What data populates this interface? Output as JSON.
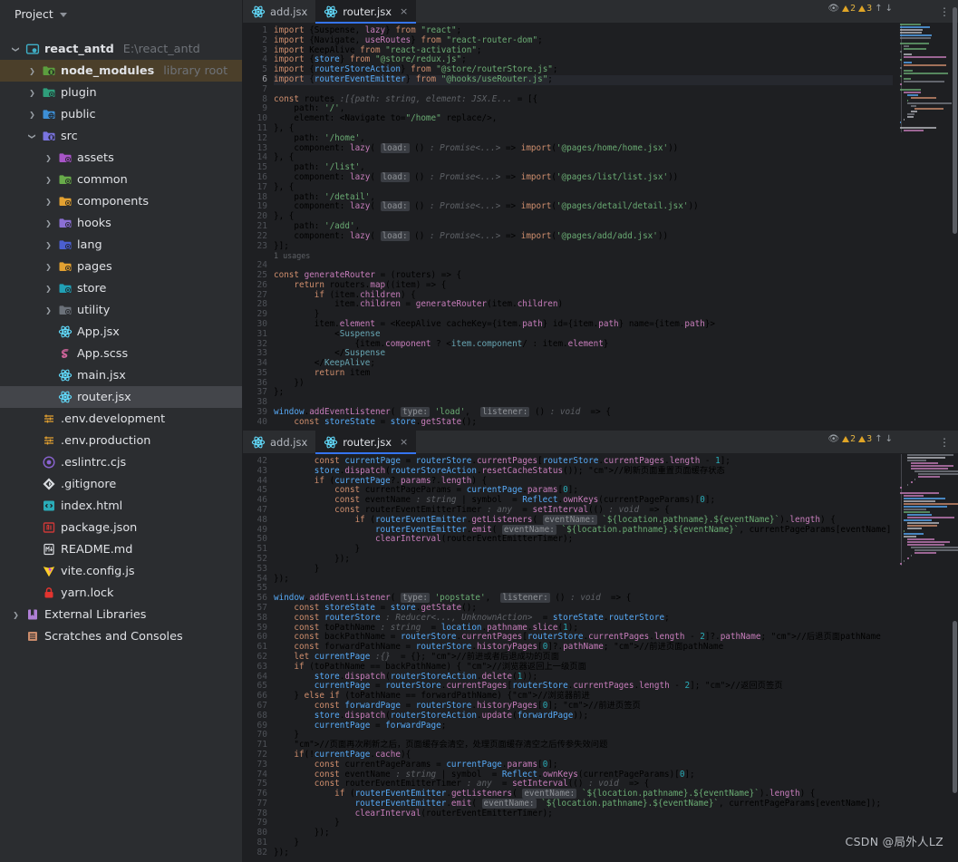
{
  "sidebar": {
    "header": {
      "title": "Project",
      "chevron_icon": "chevron-down-icon"
    },
    "items": [
      {
        "label": "react_antd",
        "sub": "E:\\react_antd",
        "icon": "module-folder-icon",
        "color": "#3fb0c8",
        "indent": 0,
        "arrow": "down",
        "bold": true,
        "state": "normal"
      },
      {
        "label": "node_modules",
        "sub": "library root",
        "icon": "library-folder-icon",
        "color": "#5c9e3e",
        "indent": 1,
        "arrow": "right",
        "bold": true,
        "state": "highlight"
      },
      {
        "label": "plugin",
        "sub": "",
        "icon": "folder-icon",
        "color": "#2f9e7b",
        "indent": 1,
        "arrow": "right",
        "bold": false,
        "state": "normal"
      },
      {
        "label": "public",
        "sub": "",
        "icon": "folder-web-icon",
        "color": "#3d8fd6",
        "indent": 1,
        "arrow": "right",
        "bold": false,
        "state": "normal"
      },
      {
        "label": "src",
        "sub": "",
        "icon": "source-folder-icon",
        "color": "#7a74e0",
        "indent": 1,
        "arrow": "down",
        "bold": false,
        "state": "normal"
      },
      {
        "label": "assets",
        "sub": "",
        "icon": "folder-icon",
        "color": "#a855c8",
        "indent": 2,
        "arrow": "right",
        "bold": false,
        "state": "normal"
      },
      {
        "label": "common",
        "sub": "",
        "icon": "folder-icon",
        "color": "#68ab4a",
        "indent": 2,
        "arrow": "right",
        "bold": false,
        "state": "normal"
      },
      {
        "label": "components",
        "sub": "",
        "icon": "folder-icon",
        "color": "#e3a131",
        "indent": 2,
        "arrow": "right",
        "bold": false,
        "state": "normal"
      },
      {
        "label": "hooks",
        "sub": "",
        "icon": "folder-icon",
        "color": "#8b6fd4",
        "indent": 2,
        "arrow": "right",
        "bold": false,
        "state": "normal"
      },
      {
        "label": "lang",
        "sub": "",
        "icon": "folder-icon",
        "color": "#4b5fd0",
        "indent": 2,
        "arrow": "right",
        "bold": false,
        "state": "normal"
      },
      {
        "label": "pages",
        "sub": "",
        "icon": "folder-icon",
        "color": "#e3a131",
        "indent": 2,
        "arrow": "right",
        "bold": false,
        "state": "normal"
      },
      {
        "label": "store",
        "sub": "",
        "icon": "folder-icon",
        "color": "#21a0b5",
        "indent": 2,
        "arrow": "right",
        "bold": false,
        "state": "normal"
      },
      {
        "label": "utility",
        "sub": "",
        "icon": "folder-icon",
        "color": "#6b7179",
        "indent": 2,
        "arrow": "right",
        "bold": false,
        "state": "normal"
      },
      {
        "label": "App.jsx",
        "sub": "",
        "icon": "react-icon",
        "color": "#61dafb",
        "indent": 2,
        "arrow": "none",
        "bold": false,
        "state": "normal"
      },
      {
        "label": "App.scss",
        "sub": "",
        "icon": "sass-icon",
        "color": "#cf649a",
        "indent": 2,
        "arrow": "none",
        "bold": false,
        "state": "normal"
      },
      {
        "label": "main.jsx",
        "sub": "",
        "icon": "react-icon",
        "color": "#61dafb",
        "indent": 2,
        "arrow": "none",
        "bold": false,
        "state": "normal"
      },
      {
        "label": "router.jsx",
        "sub": "",
        "icon": "react-icon",
        "color": "#61dafb",
        "indent": 2,
        "arrow": "none",
        "bold": false,
        "state": "selected"
      },
      {
        "label": ".env.development",
        "sub": "",
        "icon": "env-icon",
        "color": "#e3a131",
        "indent": 1,
        "arrow": "none",
        "bold": false,
        "state": "normal"
      },
      {
        "label": ".env.production",
        "sub": "",
        "icon": "env-icon",
        "color": "#e3a131",
        "indent": 1,
        "arrow": "none",
        "bold": false,
        "state": "normal"
      },
      {
        "label": ".eslintrc.cjs",
        "sub": "",
        "icon": "eslint-icon",
        "color": "#8a63d2",
        "indent": 1,
        "arrow": "none",
        "bold": false,
        "state": "normal"
      },
      {
        "label": ".gitignore",
        "sub": "",
        "icon": "git-icon",
        "color": "#d9dce0",
        "indent": 1,
        "arrow": "none",
        "bold": false,
        "state": "normal"
      },
      {
        "label": "index.html",
        "sub": "",
        "icon": "html-icon",
        "color": "#2aacb8",
        "indent": 1,
        "arrow": "none",
        "bold": false,
        "state": "normal"
      },
      {
        "label": "package.json",
        "sub": "",
        "icon": "npm-icon",
        "color": "#cb3837",
        "indent": 1,
        "arrow": "none",
        "bold": false,
        "state": "normal"
      },
      {
        "label": "README.md",
        "sub": "",
        "icon": "markdown-icon",
        "color": "#d9dce0",
        "indent": 1,
        "arrow": "none",
        "bold": false,
        "state": "normal"
      },
      {
        "label": "vite.config.js",
        "sub": "",
        "icon": "vite-icon",
        "color": "#ffd028",
        "indent": 1,
        "arrow": "none",
        "bold": false,
        "state": "normal"
      },
      {
        "label": "yarn.lock",
        "sub": "",
        "icon": "lock-icon",
        "color": "#e3342f",
        "indent": 1,
        "arrow": "none",
        "bold": false,
        "state": "normal"
      },
      {
        "label": "External Libraries",
        "sub": "",
        "icon": "libraries-icon",
        "color": "#b07fd6",
        "indent": 0,
        "arrow": "right",
        "bold": false,
        "state": "normal"
      },
      {
        "label": "Scratches and Consoles",
        "sub": "",
        "icon": "scratches-icon",
        "color": "#c98b6b",
        "indent": 0,
        "arrow": "none",
        "bold": false,
        "state": "normal"
      }
    ]
  },
  "panes": [
    {
      "id": "pane-top",
      "tabs": [
        {
          "label": "add.jsx",
          "icon": "react-icon",
          "active": false,
          "closable": false
        },
        {
          "label": "router.jsx",
          "icon": "react-icon",
          "active": true,
          "closable": true
        }
      ],
      "inspection": {
        "eye_icon": "eye-icon",
        "warning_icon": "warning-triangle-icon",
        "warnings": "2",
        "weak_warnings": "3",
        "up_icon": "arrow-up-icon",
        "down_icon": "arrow-down-icon"
      },
      "first_line": 1,
      "current_line": 6,
      "lines": [
        "import {Suspense, lazy} from \"react\";",
        "import {Navigate, useRoutes} from \"react-router-dom\";",
        "import KeepAlive from \"react-activation\";",
        "import {store} from \"@store/redux.js\";",
        "import {routerStoreAction} from \"@store/routerStore.js\";",
        "import {routerEventEmitter} from \"@hooks/useRouter.js\";",
        "",
        "const routes :[{path: string, element: JSX.E... = [{",
        "    path: '/',",
        "    element: <Navigate to=\"/home\" replace/>,",
        "}, {",
        "    path: '/home',",
        "    component: lazy( load: () : Promise<...> => import('@pages/home/home.jsx'))",
        "}, {",
        "    path: '/list',",
        "    component: lazy( load: () : Promise<...> => import('@pages/list/list.jsx'))",
        "}, {",
        "    path: '/detail',",
        "    component: lazy( load: () : Promise<...> => import('@pages/detail/detail.jsx'))",
        "}, {",
        "    path: '/add',",
        "    component: lazy( load: () : Promise<...> => import('@pages/add/add.jsx'))",
        "}];",
        "",
        "const generateRouter = (routers) => {",
        "    return routers.map((item) => {",
        "        if (item.children) {",
        "            item.children = generateRouter(item.children)",
        "        }",
        "        item.element = <KeepAlive cacheKey={item.path} id={item.path} name={item.path}>",
        "            <Suspense>",
        "                {item.component ? <item.component/> : item.element}",
        "            </Suspense>",
        "        </KeepAlive>;",
        "        return item",
        "    })",
        "};",
        "",
        "window.addEventListener( type: 'load',  listener: () : void  => {",
        "    const storeState = store.getState();"
      ],
      "usages_label": "1 usages"
    },
    {
      "id": "pane-bot",
      "tabs": [
        {
          "label": "add.jsx",
          "icon": "react-icon",
          "active": false,
          "closable": false
        },
        {
          "label": "router.jsx",
          "icon": "react-icon",
          "active": true,
          "closable": true
        }
      ],
      "inspection": {
        "eye_icon": "eye-icon",
        "warning_icon": "warning-triangle-icon",
        "warnings": "2",
        "weak_warnings": "3",
        "up_icon": "arrow-up-icon",
        "down_icon": "arrow-down-icon"
      },
      "first_line": 42,
      "lines": [
        "        const currentPage = routerStore.currentPages[routerStore.currentPages.length - 1];",
        "        store.dispatch(routerStoreAction.resetCacheStatus()); //刷新页面重置页面缓存状态",
        "        if (currentPage?.params?.length) {",
        "            const currentPageParams = currentPage.params[0];",
        "            const eventName : string | symbol  = Reflect.ownKeys(currentPageParams)[0];",
        "            const routerEventEmitterTimer : any  = setInterval(() : void  => {",
        "                if (routerEventEmitter.getListeners( eventName: `${location.pathname}.${eventName}`).length) {",
        "                    routerEventEmitter.emit( eventName: `${location.pathname}.${eventName}`, currentPageParams[eventName]);",
        "                    clearInterval(routerEventEmitterTimer);",
        "                }",
        "            });",
        "        }",
        "});",
        "",
        "window.addEventListener( type: 'popstate',  listener: () : void  => {",
        "    const storeState = store.getState();",
        "    const routerStore : Reducer<..., UnknownAction>  = storeState.routerStore;",
        "    const toPathName : string  = location.pathname.slice(1);",
        "    const backPathName = routerStore.currentPages[routerStore.currentPages.length - 2]?.pathName; //后退页面pathName",
        "    const forwardPathName = routerStore.historyPages[0]?.pathName; //前进页面pathName",
        "    let currentPage :{}  = {}; //前进或者后退成功的页面",
        "    if (toPathName == backPathName) { //浏览器返回上一级页面",
        "        store.dispatch(routerStoreAction.delete(1));",
        "        currentPage = routerStore.currentPages[routerStore.currentPages.length - 2]; //返回页签页",
        "    } else if (toPathName == forwardPathName) {//浏览器前进",
        "        const forwardPage = routerStore.historyPages[0]; //前进页签页",
        "        store.dispatch(routerStoreAction.update(forwardPage));",
        "        currentPage = forwardPage;",
        "    }",
        "    //页面再次刷新之后，页面缓存会清空，处理页面缓存清空之后传参失效问题",
        "    if(!currentPage.cache){",
        "        const currentPageParams = currentPage.params[0];",
        "        const eventName : string | symbol  = Reflect.ownKeys(currentPageParams)[0];",
        "        const routerEventEmitterTimer : any  = setInterval(() : void  => {",
        "            if (routerEventEmitter.getListeners( eventName: `${location.pathname}.${eventName}`).length) {",
        "                routerEventEmitter.emit( eventName: `${location.pathname}.${eventName}`, currentPageParams[eventName]);",
        "                clearInterval(routerEventEmitterTimer);",
        "            }",
        "        });",
        "    }",
        "});"
      ]
    }
  ],
  "watermark": {
    "text": "CSDN @局外人LZ"
  },
  "colors": {
    "background": "#2b2d30",
    "editor_background": "#1e1f22",
    "accent": "#3574f0",
    "selection": "#43454a",
    "highlight_row": "#4b3f2a",
    "keyword": "#cf8e6d",
    "string": "#6aab73",
    "number": "#2aacb8",
    "function": "#57aaf7",
    "comment": "#7a7e85",
    "warning": "#e0a526"
  }
}
